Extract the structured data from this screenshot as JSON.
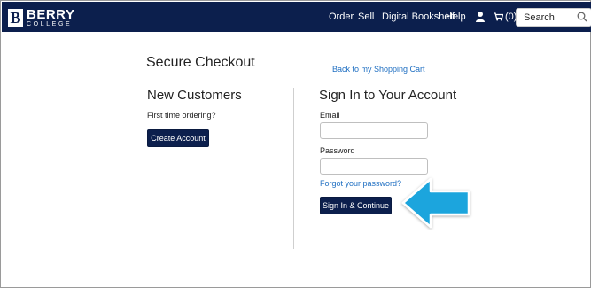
{
  "header": {
    "logo_letter": "B",
    "logo_name": "BERRY",
    "logo_sub": "COLLEGE",
    "nav": [
      "Order",
      "Sell",
      "Digital Bookshelf",
      "Help"
    ],
    "cart_label": "(0)",
    "search_placeholder": "Search",
    "brand_color": "#0c1f4d"
  },
  "checkout": {
    "title": "Secure Checkout",
    "back_link": "Back to my Shopping Cart",
    "new_customers": {
      "heading": "New Customers",
      "prompt": "First time ordering?",
      "button": "Create Account"
    },
    "sign_in": {
      "heading": "Sign In to Your Account",
      "email_label": "Email",
      "email_value": "",
      "password_label": "Password",
      "password_value": "",
      "forgot_link": "Forgot your password?",
      "button": "Sign In & Continue"
    },
    "link_color": "#1f6fc2",
    "callout_arrow_color": "#1aa5dd"
  },
  "icons": {
    "user": "user-icon",
    "cart": "cart-icon",
    "search": "search-icon",
    "callout": "arrow-left-icon"
  }
}
